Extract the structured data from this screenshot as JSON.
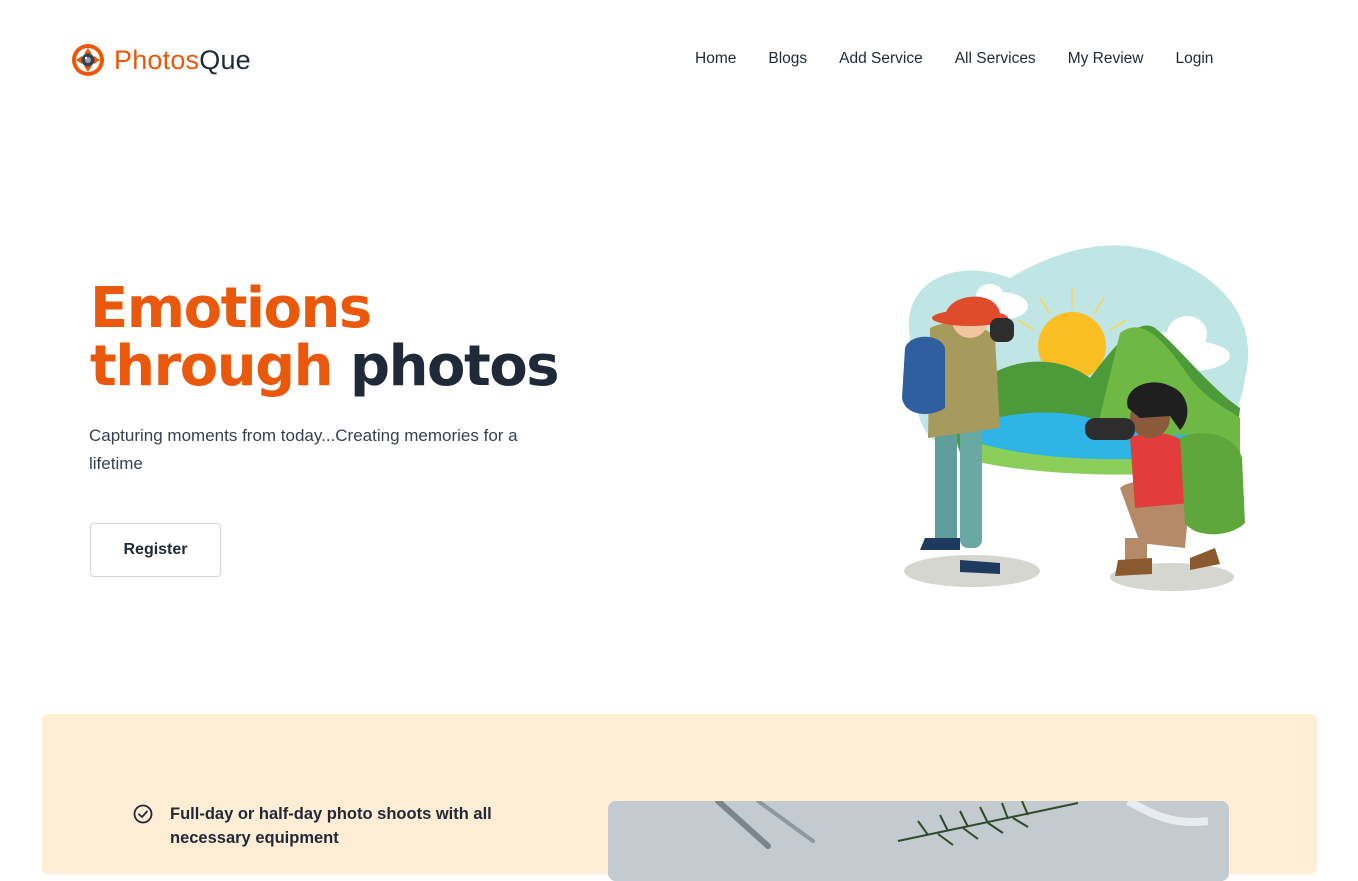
{
  "brand": {
    "name_part1": "Photos",
    "name_part2": "Que",
    "accent": "#ea580c",
    "dark": "#1f2937"
  },
  "nav": {
    "items": [
      {
        "label": "Home"
      },
      {
        "label": "Blogs"
      },
      {
        "label": "Add Service"
      },
      {
        "label": "All Services"
      },
      {
        "label": "My Review"
      },
      {
        "label": "Login"
      }
    ]
  },
  "hero": {
    "title_line1": "Emotions",
    "title_line2_accent": "through",
    "title_line2_dark": "photos",
    "subtitle": "Capturing moments from today...Creating memories for a lifetime",
    "cta_label": "Register",
    "illustration": "photographers-illustration"
  },
  "features": {
    "background": "#ffedd5",
    "items": [
      {
        "icon": "check-circle-icon",
        "text": "Full-day or half-day photo shoots with all necessary equipment"
      }
    ],
    "photo": "table-setting-photo"
  }
}
